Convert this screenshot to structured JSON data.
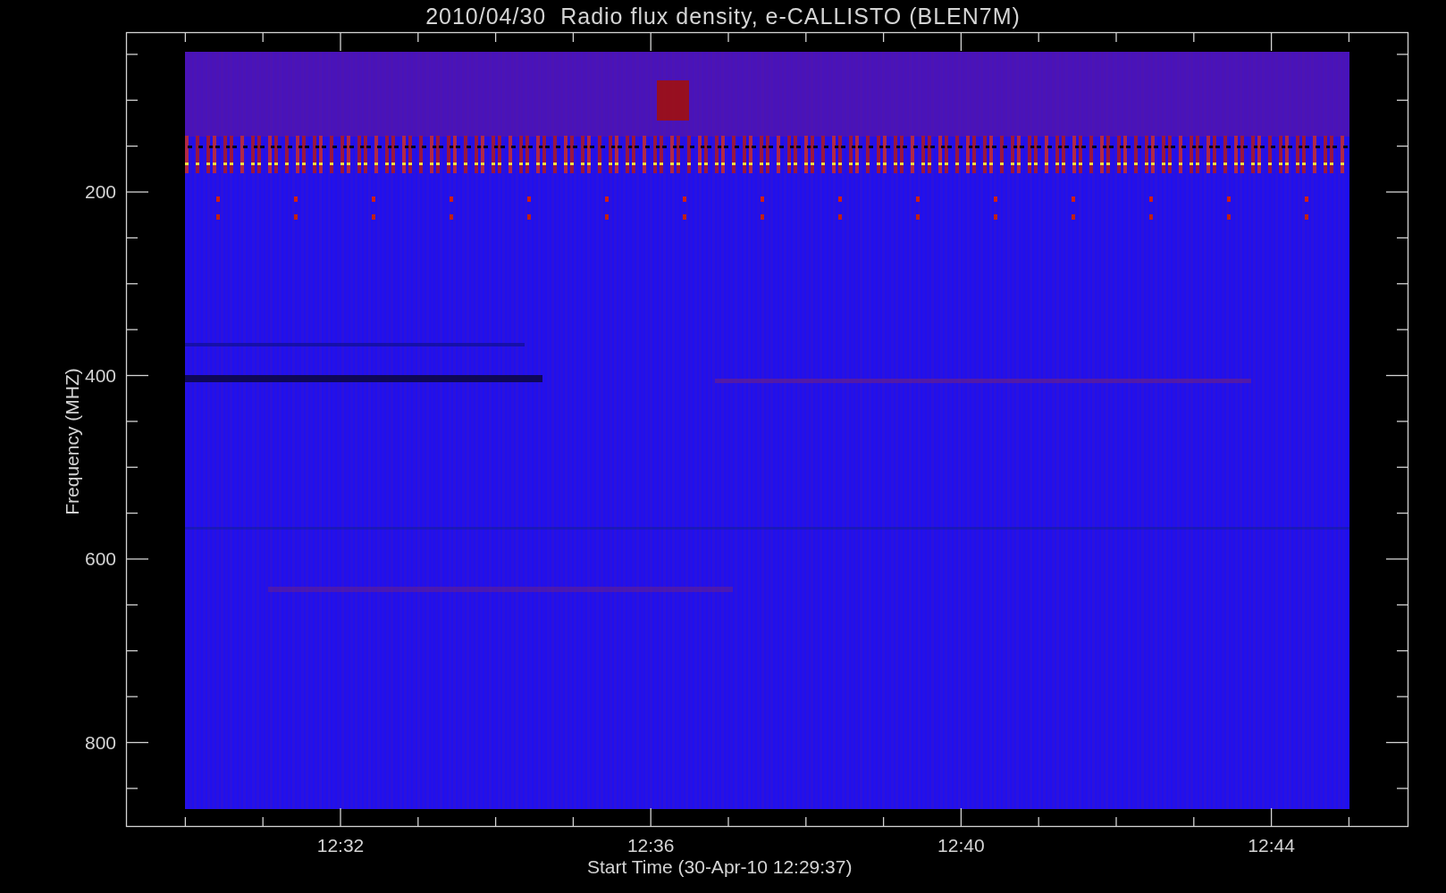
{
  "title": "2010/04/30  Radio flux density, e-CALLISTO (BLEN7M)",
  "y_axis": {
    "label": "Frequency (MHZ)",
    "ticks": [
      "200",
      "400",
      "600",
      "800"
    ]
  },
  "x_axis": {
    "label": "Start Time (30-Apr-10 12:29:37)",
    "ticks": [
      "12:32",
      "12:36",
      "12:40",
      "12:44"
    ]
  }
}
